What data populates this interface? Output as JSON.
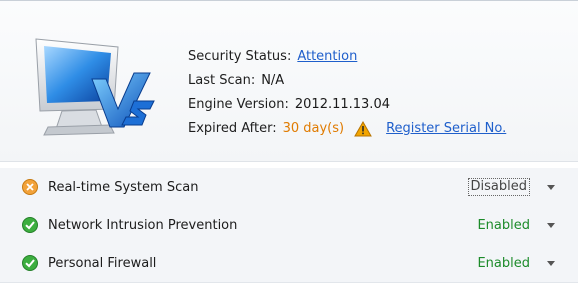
{
  "status": {
    "security_label": "Security Status:",
    "security_value": "Attention",
    "last_scan_label": "Last Scan:",
    "last_scan_value": "N/A",
    "engine_label": "Engine Version:",
    "engine_value": "2012.11.13.04",
    "expired_label": "Expired After:",
    "expired_value": "30 day(s)",
    "register_link": "Register Serial No."
  },
  "features": [
    {
      "name": "Real-time System Scan",
      "state": "Disabled",
      "status_icon": "warning-circle-icon"
    },
    {
      "name": "Network Intrusion Prevention",
      "state": "Enabled",
      "status_icon": "check-circle-icon"
    },
    {
      "name": "Personal Firewall",
      "state": "Enabled",
      "status_icon": "check-circle-icon"
    }
  ],
  "colors": {
    "link": "#1f5fcb",
    "warning": "#e07b00",
    "enabled": "#1c8b2a",
    "row_bg": "#f3f5f8"
  },
  "icons": [
    "monitor-v-logo",
    "warning-triangle-icon",
    "warning-circle-icon",
    "check-circle-icon",
    "dropdown-caret-icon"
  ]
}
